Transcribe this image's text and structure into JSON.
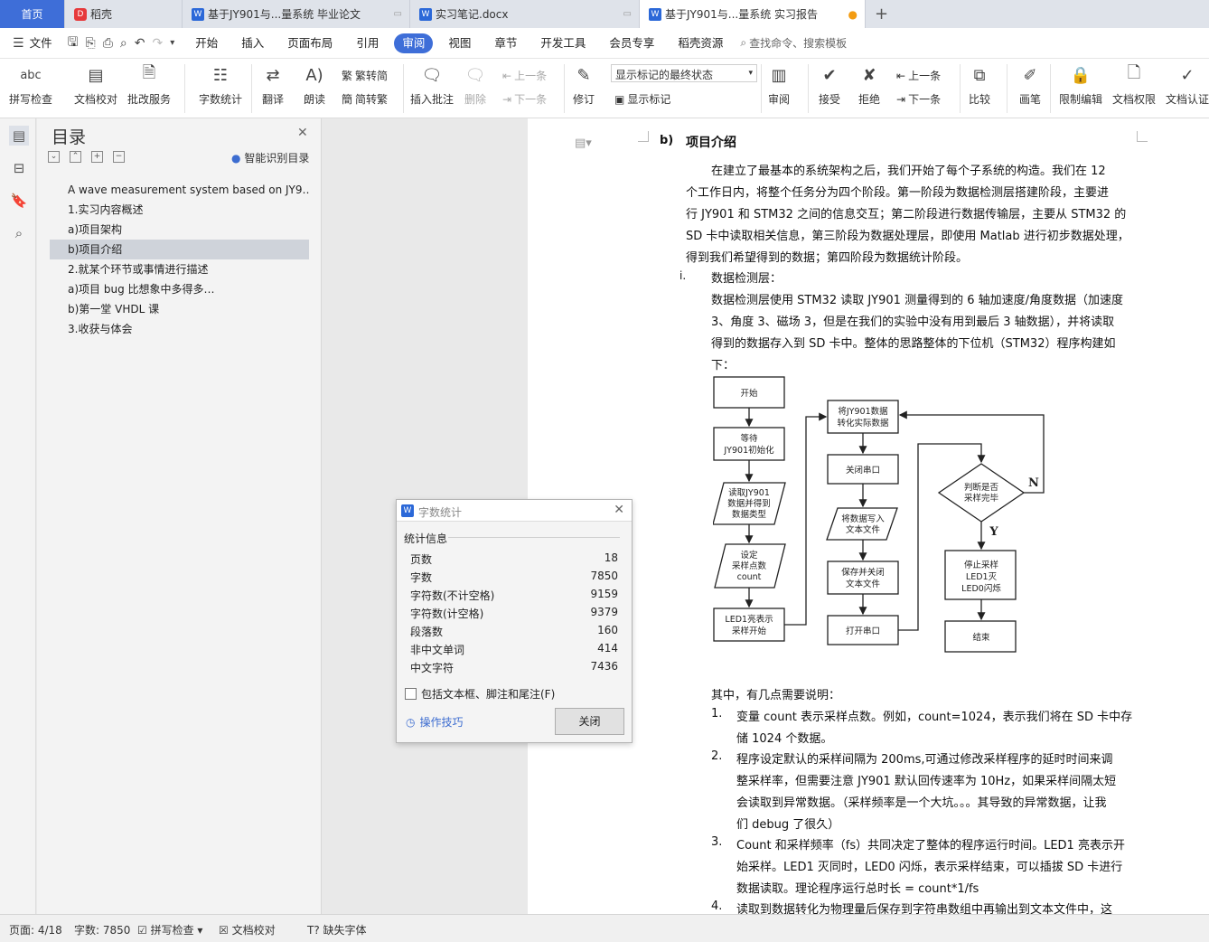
{
  "tabs": {
    "home": "首页",
    "t1": "稻壳",
    "t2": "基于JY901与...量系统 毕业论文",
    "t3": "实习笔记.docx",
    "t4": "基于JY901与...量系统 实习报告",
    "add": "+"
  },
  "menu": {
    "file": "文件",
    "items": [
      "开始",
      "插入",
      "页面布局",
      "引用",
      "审阅",
      "视图",
      "章节",
      "开发工具",
      "会员专享",
      "稻壳资源"
    ],
    "search": "查找命令、搜索模板"
  },
  "ribbon": {
    "spell": "拼写检查",
    "proof": "文档校对",
    "review_service": "批改服务",
    "wordcount": "字数统计",
    "translate": "翻译",
    "read": "朗读",
    "trad": "繁转简",
    "simp": "简转繁",
    "insert_comment": "插入批注",
    "delete": "删除",
    "prev": "上一条",
    "next": "下一条",
    "revise": "修订",
    "show_select": "显示标记的最终状态",
    "show_marks": "显示标记",
    "review": "审阅",
    "accept": "接受",
    "reject": "拒绝",
    "prev2": "上一条",
    "next2": "下一条",
    "compare": "比较",
    "pen": "画笔",
    "restrict": "限制编辑",
    "perm": "文档权限",
    "cert": "文档认证"
  },
  "toc": {
    "title": "目录",
    "smart": "智能识别目录",
    "items": [
      "A wave measurement system based on JY9…",
      "1.实习内容概述",
      "a)项目架构",
      "b)项目介绍",
      "2.就某个环节或事情进行描述",
      "a)项目 bug 比想象中多得多…",
      "b)第一堂 VHDL 课",
      "3.收获与体会"
    ]
  },
  "doc": {
    "heading_num": "b)",
    "heading": "项目介绍",
    "para": [
      "在建立了最基本的系统架构之后，我们开始了每个子系统的构造。我们在 12",
      "个工作日内，将整个任务分为四个阶段。第一阶段为数据检测层搭建阶段，主要进",
      "行 JY901 和 STM32 之间的信息交互；第二阶段进行数据传输层，主要从 STM32 的",
      "SD 卡中读取相关信息，第三阶段为数据处理层，即使用 Matlab 进行初步数据处理，",
      "得到我们希望得到的数据；第四阶段为数据统计阶段。"
    ],
    "li_num": "i.",
    "li_title": "数据检测层：",
    "li_para": [
      "数据检测层使用 STM32 读取 JY901 测量得到的 6 轴加速度/角度数据（加速度",
      "3、角度 3、磁场 3，但是在我们的实验中没有用到最后 3 轴数据），并将读取",
      "得到的数据存入到 SD 卡中。整体的思路整体的下位机（STM32）程序构建如",
      "下："
    ],
    "notes_intro": "其中，有几点需要说明：",
    "n1": [
      "变量 count 表示采样点数。例如，count=1024，表示我们将在 SD 卡中存",
      "储 1024 个数据。"
    ],
    "n2": [
      "程序设定默认的采样间隔为 200ms,可通过修改采样程序的延时时间来调",
      "整采样率，但需要注意 JY901 默认回传速率为 10Hz，如果采样间隔太短",
      "会读取到异常数据。（采样频率是一个大坑。。。其导致的异常数据，让我",
      "们 debug 了很久）"
    ],
    "n3": [
      "Count 和采样频率（fs）共同决定了整体的程序运行时间。LED1 亮表示开",
      "始采样。LED1 灭同时，LED0 闪烁，表示采样结束，可以插拔 SD 卡进行",
      "数据读取。理论程序运行总时长 = count*1/fs"
    ],
    "n4": [
      "读取到数据转化为物理量后保存到字符串数组中再输出到文本文件中，这"
    ],
    "nums": [
      "1.",
      "2.",
      "3.",
      "4."
    ]
  },
  "flow": {
    "start": "开始",
    "wait": [
      "等待",
      "JY901初始化"
    ],
    "read": [
      "读取JY901",
      "数据并得到",
      "数据类型"
    ],
    "set": [
      "设定",
      "采样点数",
      "count"
    ],
    "led": [
      "LED1亮表示",
      "采样开始"
    ],
    "convert": [
      "将JY901数据",
      "转化实际数据"
    ],
    "close": "关闭串口",
    "write": [
      "将数据写入",
      "文本文件"
    ],
    "save": [
      "保存并关闭",
      "文本文件"
    ],
    "open": "打开串口",
    "judge": [
      "判断是否",
      "采样完毕"
    ],
    "n": "N",
    "y": "Y",
    "stop": [
      "停止采样",
      "LED1灭",
      "LED0闪烁"
    ],
    "end": "结束"
  },
  "dialog": {
    "title": "字数统计",
    "section": "统计信息",
    "rows": [
      {
        "k": "页数",
        "v": "18"
      },
      {
        "k": "字数",
        "v": "7850"
      },
      {
        "k": "字符数(不计空格)",
        "v": "9159"
      },
      {
        "k": "字符数(计空格)",
        "v": "9379"
      },
      {
        "k": "段落数",
        "v": "160"
      },
      {
        "k": "非中文单词",
        "v": "414"
      },
      {
        "k": "中文字符",
        "v": "7436"
      }
    ],
    "include": "包括文本框、脚注和尾注(F)",
    "tips": "操作技巧",
    "close": "关闭"
  },
  "status": {
    "page": "页面: 4/18",
    "words": "字数: 7850",
    "spell": "拼写检查",
    "proof": "文档校对",
    "font": "缺失字体"
  }
}
